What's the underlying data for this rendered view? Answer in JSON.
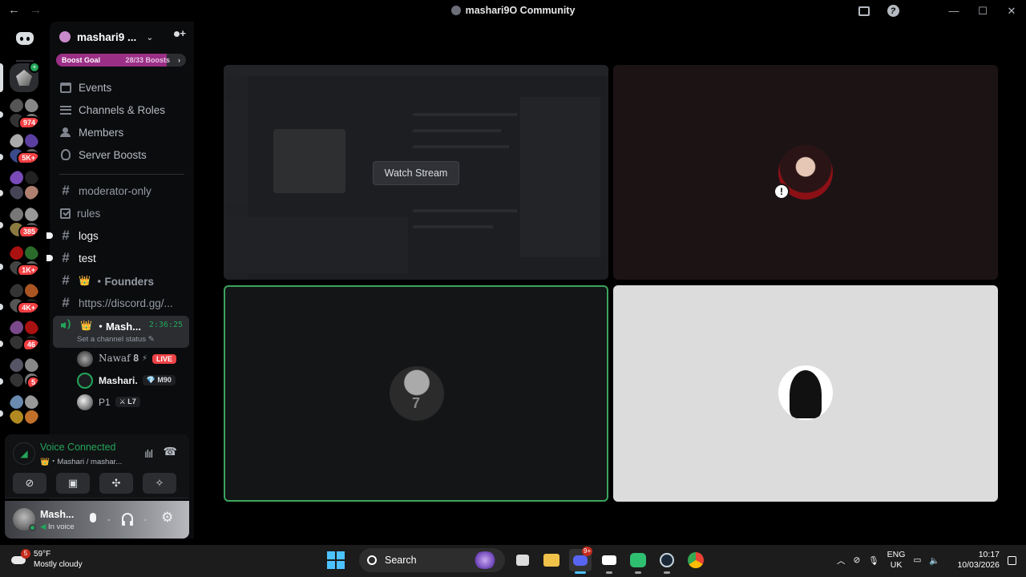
{
  "window": {
    "title": "mashari9O Community",
    "back": "←",
    "forward": "→",
    "min": "—",
    "max": "☐",
    "close": "✕",
    "help": "?"
  },
  "server_badges": [
    "974",
    "5K+",
    "385",
    "1K+",
    "4K+",
    "46",
    "5"
  ],
  "guild": {
    "name": "mashari9 ...",
    "chevron": "⌄",
    "boost_label": "Boost Goal",
    "boost_count": "28/33 Boosts",
    "boost_fraction": 0.85,
    "boost_color": "#9b2f86"
  },
  "menu": [
    {
      "label": "Events"
    },
    {
      "label": "Channels & Roles"
    },
    {
      "label": "Members"
    },
    {
      "label": "Server Boosts"
    }
  ],
  "channels": {
    "moderator_only": "moderator-only",
    "rules": "rules",
    "logs": "logs",
    "test": "test",
    "founders": "・Founders",
    "invite": "https://discord.gg/...",
    "voice_name": "・Mash...",
    "voice_timer": "2:36:25",
    "voice_status": "Set a channel status"
  },
  "voice_users": [
    {
      "name": "Nawaf 𝟖",
      "extra": "⚡",
      "badge": "LIVE"
    },
    {
      "name": "Mashari.",
      "badge": "💎 M90"
    },
    {
      "name": "P1",
      "badge": "⚔ L7"
    }
  ],
  "voice_connection": {
    "title": "Voice Connected",
    "subtitle": "👑・Mashari / mashar...",
    "accent": "#23a55a"
  },
  "user": {
    "name": "Mash...",
    "status": "In voice"
  },
  "stage": {
    "watch_label": "Watch Stream",
    "speaking_color": "#3ba55d"
  },
  "weather": {
    "temp": "59°F",
    "desc": "Mostly cloudy",
    "alert": "5"
  },
  "taskbar": {
    "search": "Search",
    "discord_badge": "9+"
  },
  "tray": {
    "lang1": "ENG",
    "lang2": "UK",
    "time": "10:17",
    "date": "10/03/2026"
  }
}
